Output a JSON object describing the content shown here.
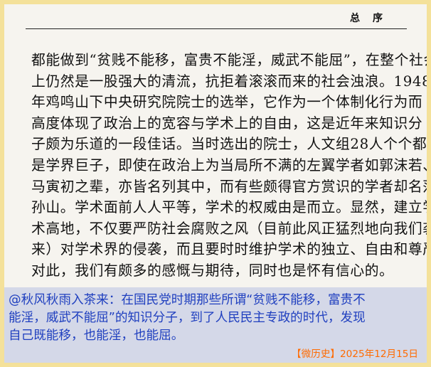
{
  "header": {
    "title": "总序"
  },
  "body": {
    "lines": [
      "都能做到“贫贱不能移，富贵不能淫，威武不能屈”，在整个社会",
      "上仍然是一股强大的清流，抗拒着滚滚而来的社会浊浪。1948",
      "年鸡鸣山下中央研究院院士的选举，它作为一个体制化行为而",
      "高度体现了政治上的宽容与学术上的自由，这是近年来知识分",
      "子颇为乐道的一段佳话。当时选出的院士，人文组28人个个都",
      "是学界巨子，即使在政治上为当局所不满的左翼学者如郭沫若、",
      "马寅初之辈，亦皆名列其中，而有些颇得官方赏识的学者却名落",
      "孙山。学术面前人人平等，学术的权威由是而立。显然，建立学",
      "术高地，不仅要严防社会腐败之风（目前此风正猛烈地向我们袭",
      "来）对学术界的侵袭，而且要时时维护学术的独立、自由和尊严，",
      "对此，我们有颇多的感慨与期待，同时也是怀有信心的。"
    ]
  },
  "comment": {
    "lines": [
      "@秋风秋雨入茶来：在国民党时期那些所谓“贫贱不能移，富贵不",
      "能淫，威武不能屈”的知识分子，到了人民民主专政的时代，发现",
      "自己既能移，也能淫，也能屈。"
    ],
    "source": "【微历史】2025年12月15日"
  },
  "colors": {
    "outer_border": "#f4e19a",
    "page_bg": "#f6f4ef",
    "comment_bg": "#d4d8e8",
    "comment_text": "#1f3fbf",
    "source_text": "#ff6a00"
  }
}
